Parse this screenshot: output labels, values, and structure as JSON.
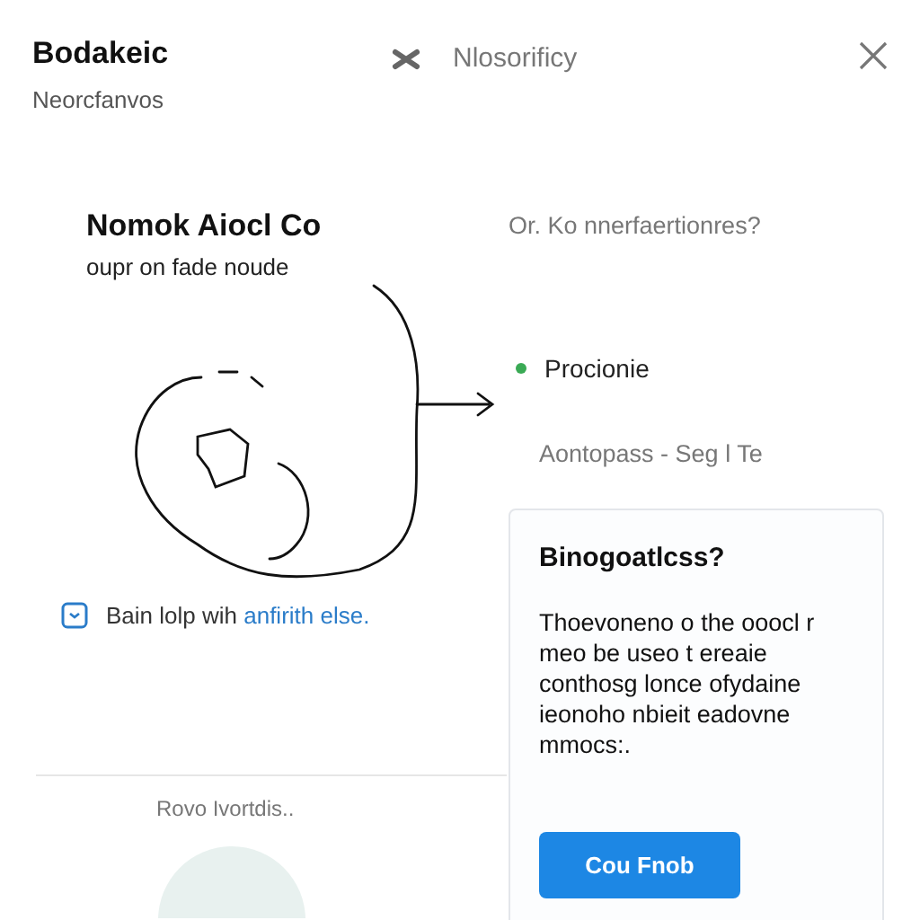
{
  "header": {
    "title": "Bodakeic",
    "subtitle": "Neorcfanvos",
    "center_label": "Nlosorificy"
  },
  "left": {
    "heading": "Nomok Aiocl Co",
    "caption": "oupr on fade noude",
    "help_text": "Bain lolp wih ",
    "help_link": "anfirith else.",
    "footer_label": "Rovo Ivortdis.."
  },
  "right": {
    "question": "Or. Ko nnerfaertionres?",
    "status": {
      "label": "Procionie",
      "color": "#3aaa55"
    },
    "meta": "Aontopass - Seg l Te",
    "card": {
      "title": "Binogoatlcss?",
      "body": "Thoevoneno o the ooocl r meo be useo t ereaie conthosg lonce ofydaine ieonoho nbieit eadovne mmocs:.",
      "button": "Cou Fnob"
    }
  }
}
